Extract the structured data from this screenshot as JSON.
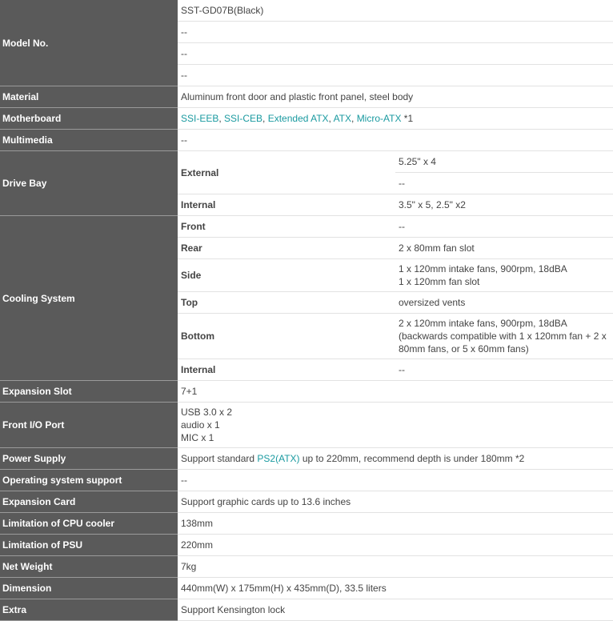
{
  "rows": {
    "model": {
      "label": "Model No.",
      "values": [
        "SST-GD07B(Black)",
        "--",
        "--",
        "--"
      ]
    },
    "material": {
      "label": "Material",
      "value": "Aluminum front door and plastic front panel, steel body"
    },
    "motherboard": {
      "label": "Motherboard",
      "links": [
        "SSI-EEB",
        "SSI-CEB",
        "Extended ATX",
        "ATX",
        "Micro-ATX"
      ],
      "sep": ", ",
      "note": " *1"
    },
    "multimedia": {
      "label": "Multimedia",
      "value": "--"
    },
    "drive_bay": {
      "label": "Drive Bay",
      "external_label": "External",
      "external_values": [
        "5.25\" x 4",
        "--"
      ],
      "internal_label": "Internal",
      "internal_value": "3.5\" x 5, 2.5\" x2"
    },
    "cooling": {
      "label": "Cooling System",
      "front_label": "Front",
      "front_value": "--",
      "rear_label": "Rear",
      "rear_value": "2 x 80mm fan slot",
      "side_label": "Side",
      "side_line1": "1 x 120mm intake fans, 900rpm, 18dBA",
      "side_line2": "1 x 120mm fan slot",
      "top_label": "Top",
      "top_value": "oversized vents",
      "bottom_label": "Bottom",
      "bottom_line1": "2 x 120mm intake fans, 900rpm, 18dBA",
      "bottom_line2": "(backwards compatible with 1 x 120mm fan + 2 x 80mm fans, or 5 x 60mm fans)",
      "internal_label": "Internal",
      "internal_value": "--"
    },
    "expansion_slot": {
      "label": "Expansion Slot",
      "value": "7+1"
    },
    "front_io": {
      "label": "Front I/O Port",
      "line1": "USB 3.0 x 2",
      "line2": "audio x 1",
      "line3": "MIC x 1"
    },
    "power_supply": {
      "label": "Power Supply",
      "prefix": "Support standard ",
      "link": "PS2(ATX)",
      "suffix": " up to 220mm, recommend depth is under 180mm *2"
    },
    "os_support": {
      "label": "Operating system support",
      "value": "--"
    },
    "expansion_card": {
      "label": "Expansion Card",
      "value": "Support graphic cards up to 13.6 inches"
    },
    "cpu_cooler": {
      "label": "Limitation of CPU cooler",
      "value": "138mm"
    },
    "psu_limit": {
      "label": "Limitation of PSU",
      "value": "220mm"
    },
    "net_weight": {
      "label": "Net Weight",
      "value": "7kg"
    },
    "dimension": {
      "label": "Dimension",
      "value": "440mm(W) x 175mm(H) x 435mm(D), 33.5 liters"
    },
    "extra": {
      "label": "Extra",
      "value": "Support Kensington lock"
    }
  }
}
